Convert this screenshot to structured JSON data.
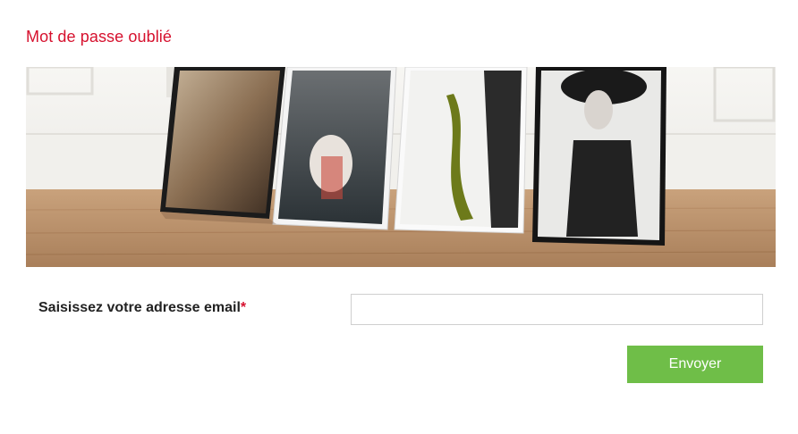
{
  "page": {
    "title": "Mot de passe oublié",
    "accent_color": "#d6112e"
  },
  "form": {
    "email_label": "Saisissez votre adresse email",
    "required_marker": "*",
    "email_value": "",
    "submit_label": "Envoyer",
    "submit_color": "#6fbe48"
  },
  "banner": {
    "image_semantic": "four framed photographs leaning against a white wall on a wooden floor"
  }
}
